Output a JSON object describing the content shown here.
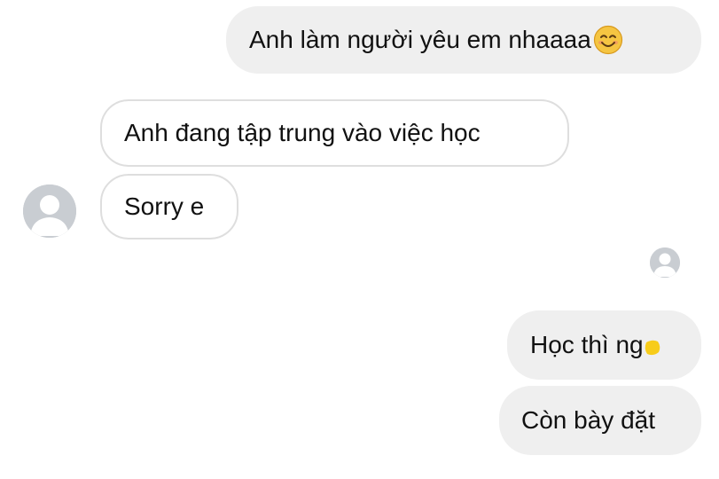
{
  "conversation": {
    "messages": [
      {
        "sender": "me",
        "text": "Anh làm người yêu em nhaaaa",
        "emoji": "smiling-face-icon"
      },
      {
        "sender": "contact",
        "text": "Anh đang tập trung vào việc học"
      },
      {
        "sender": "contact",
        "text": "Sorry e"
      },
      {
        "sender": "me",
        "text": "Học thì ng",
        "redaction": "yellow-censor-mark"
      },
      {
        "sender": "me",
        "text": "Còn bày đặt"
      }
    ]
  },
  "colors": {
    "outgoing_bubble": "#efefef",
    "incoming_bubble_border": "#dedede",
    "avatar_placeholder": "#c9cdd2",
    "emoji_yellow": "#f5c542",
    "censor_yellow": "#f7cc1a"
  }
}
